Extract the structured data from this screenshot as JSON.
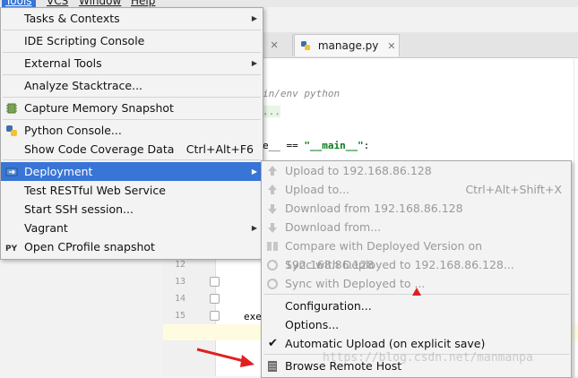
{
  "menubar": {
    "items": [
      {
        "label": "Tools",
        "active": true
      },
      {
        "label": "VCS",
        "active": false
      },
      {
        "label": "Window",
        "active": false
      },
      {
        "label": "Help",
        "active": false
      }
    ]
  },
  "editor": {
    "tabs": [
      {
        "label": "n"
      },
      {
        "label": "manage.py"
      }
    ],
    "line_numbers": [
      "12",
      "13",
      "14",
      "15",
      "16"
    ],
    "code": {
      "shebang": "in/env python",
      "dots": "...",
      "main_check_prefix": "e__ == ",
      "main_check_str": "\"__main__\"",
      "main_check_suffix": ":",
      "exec_line": "exec"
    },
    "watermark": "https://blog.csdn.net/manmanpa"
  },
  "tools_menu": {
    "items": [
      {
        "label": "Tasks & Contexts",
        "submenu": true
      },
      {
        "label": "IDE Scripting Console"
      },
      {
        "label": "External Tools",
        "submenu": true
      },
      {
        "label": "Analyze Stacktrace..."
      },
      {
        "label": "Capture Memory Snapshot",
        "icon": "memory-snapshot-icon"
      },
      {
        "label": "Python Console...",
        "icon": "python-icon"
      },
      {
        "label": "Show Code Coverage Data",
        "shortcut": "Ctrl+Alt+F6"
      },
      {
        "label": "Deployment",
        "submenu": true,
        "selected": true,
        "icon": "deployment-icon"
      },
      {
        "label": "Test RESTful Web Service"
      },
      {
        "label": "Start SSH session..."
      },
      {
        "label": "Vagrant",
        "submenu": true
      },
      {
        "label": "Open CProfile snapshot",
        "icon": "cprofile-icon"
      }
    ]
  },
  "deployment_menu": {
    "items": [
      {
        "label": "Upload to 192.168.86.128",
        "disabled": true
      },
      {
        "label": "Upload to...",
        "shortcut": "Ctrl+Alt+Shift+X",
        "disabled": true
      },
      {
        "label": "Download from 192.168.86.128",
        "disabled": true
      },
      {
        "label": "Download from...",
        "disabled": true
      },
      {
        "label": "Compare with Deployed Version on 192.168.86.128",
        "disabled": true
      },
      {
        "label": "Sync with Deployed to 192.168.86.128...",
        "disabled": true
      },
      {
        "label": "Sync with Deployed to ...",
        "disabled": true
      },
      {
        "label": "Configuration..."
      },
      {
        "label": "Options..."
      },
      {
        "label": "Automatic Upload (on explicit save)",
        "checked": true
      },
      {
        "label": "Browse Remote Host",
        "icon": "remote-host-icon"
      }
    ]
  }
}
